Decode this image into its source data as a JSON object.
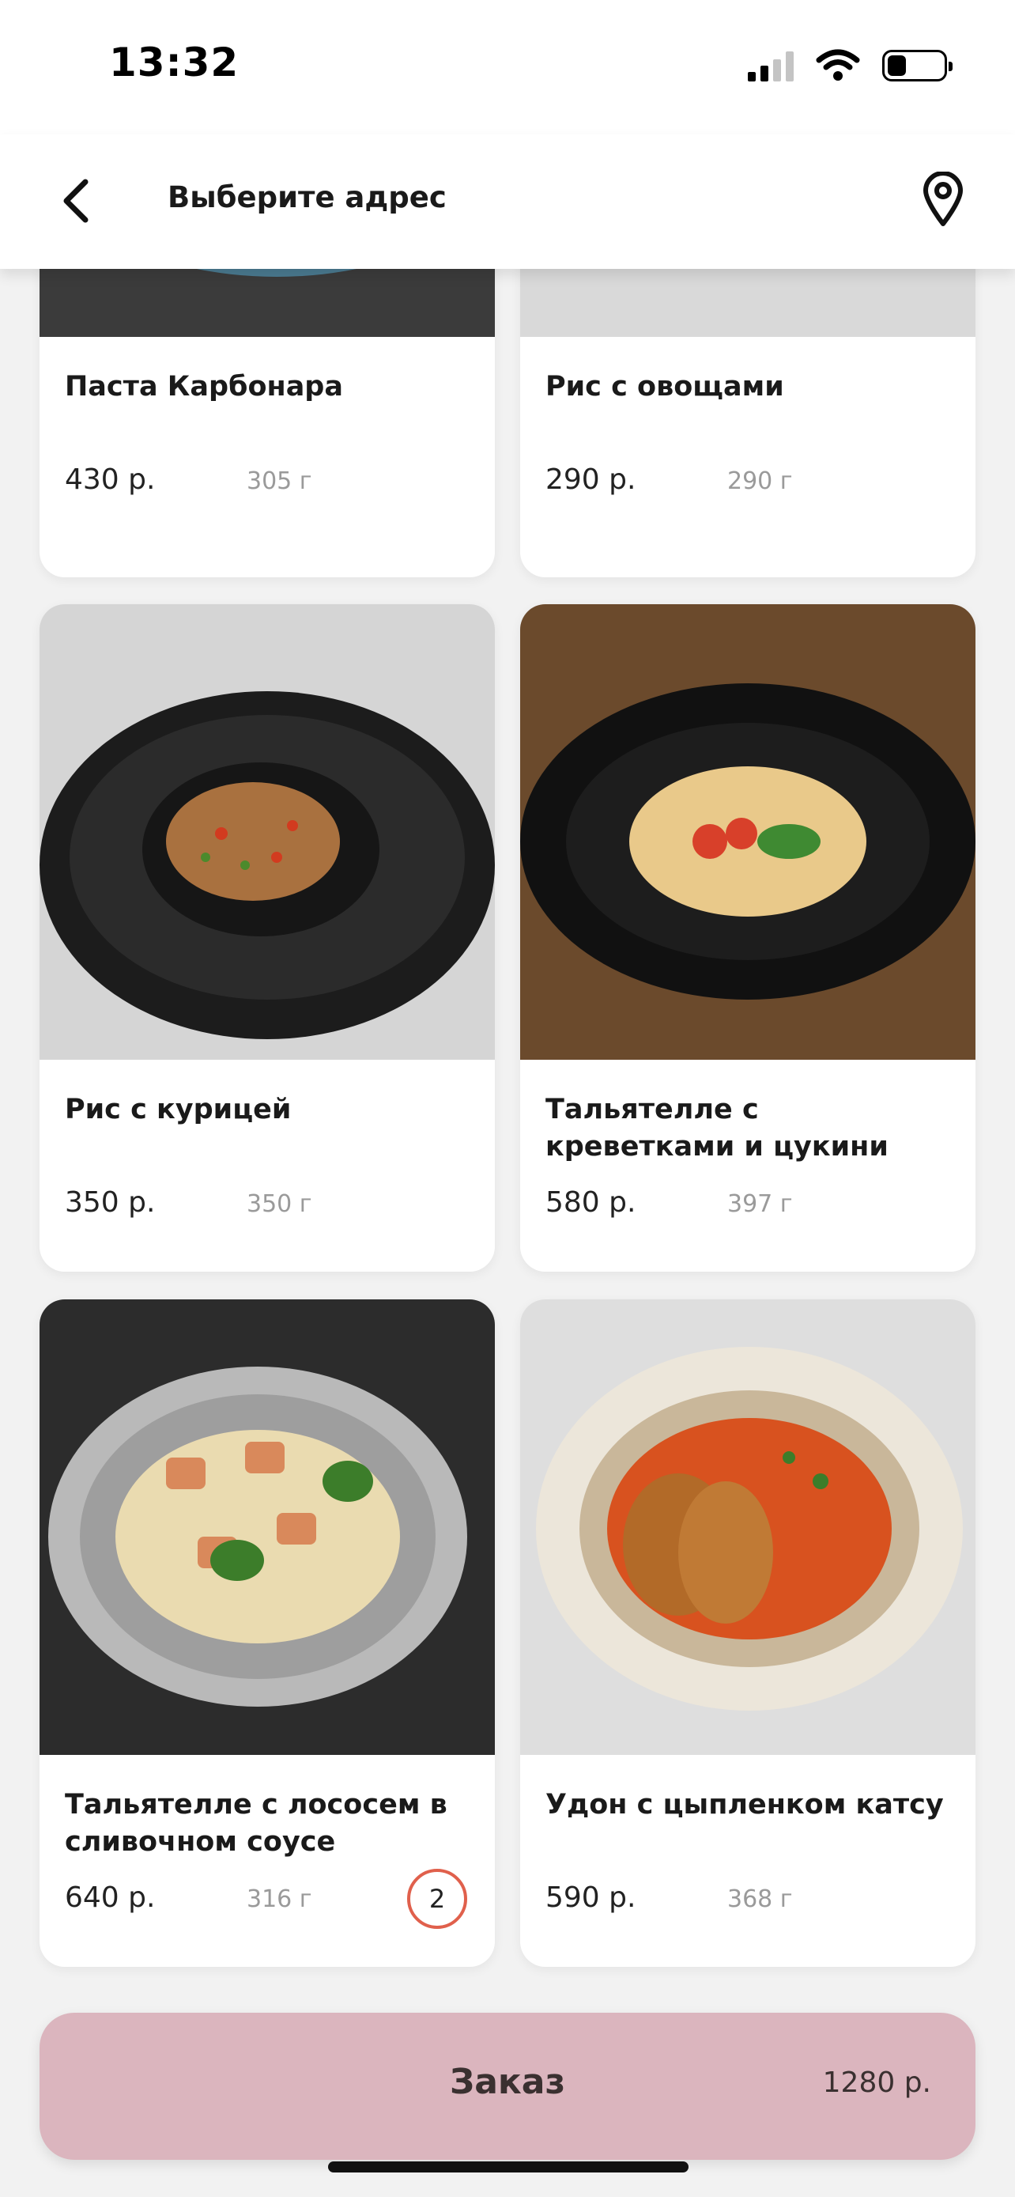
{
  "status_bar": {
    "time": "13:32"
  },
  "header": {
    "title": "Выберите адрес"
  },
  "products": [
    {
      "name": "Паста Карбонара",
      "price": "430 р.",
      "weight": "305 г"
    },
    {
      "name": "Рис с овощами",
      "price": "290 р.",
      "weight": "290 г"
    },
    {
      "name": "Рис с курицей",
      "price": "350 р.",
      "weight": "350 г"
    },
    {
      "name": "Тальятелле с креветками и цукини",
      "price": "580 р.",
      "weight": "397 г"
    },
    {
      "name": "Тальятелле с лососем в сливочном соусе",
      "price": "640 р.",
      "weight": "316 г",
      "quantity": "2"
    },
    {
      "name": "Удон с цыпленком катсу",
      "price": "590 р.",
      "weight": "368 г"
    }
  ],
  "order_bar": {
    "label": "Заказ",
    "total": "1280 р."
  },
  "colors": {
    "order_bar": "#dbb5be",
    "quantity_ring": "#e0604c",
    "background": "#f2f2f2"
  }
}
